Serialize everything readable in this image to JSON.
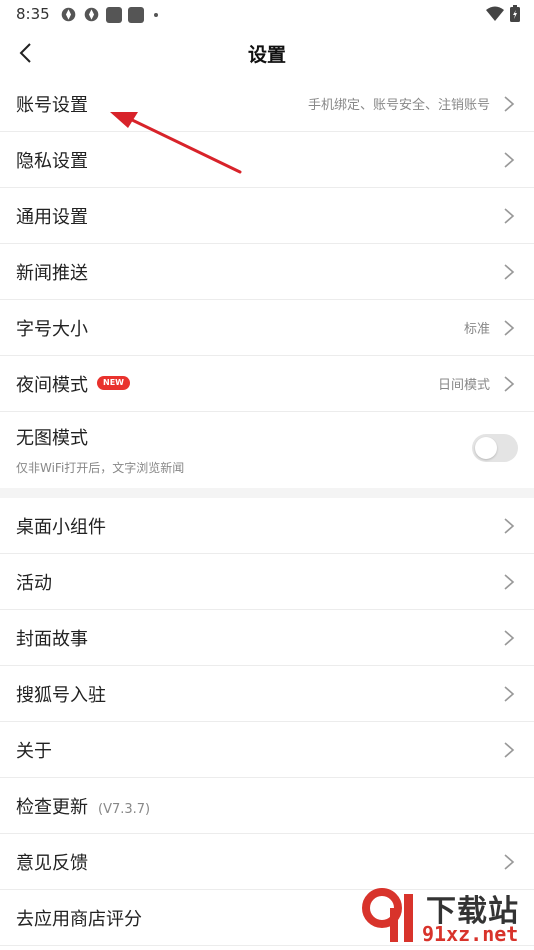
{
  "status": {
    "time": "8:35"
  },
  "header": {
    "title": "设置"
  },
  "rows": {
    "account": {
      "label": "账号设置",
      "value": "手机绑定、账号安全、注销账号"
    },
    "privacy": {
      "label": "隐私设置"
    },
    "general": {
      "label": "通用设置"
    },
    "news_push": {
      "label": "新闻推送"
    },
    "font_size": {
      "label": "字号大小",
      "value": "标准"
    },
    "night_mode": {
      "label": "夜间模式",
      "badge": "NEW",
      "value": "日间模式"
    },
    "no_image": {
      "label": "无图模式",
      "sub": "仅非WiFi打开后，文字浏览新闻",
      "enabled": false
    },
    "widget": {
      "label": "桌面小组件"
    },
    "activity": {
      "label": "活动"
    },
    "cover_story": {
      "label": "封面故事"
    },
    "sohu_account": {
      "label": "搜狐号入驻"
    },
    "about": {
      "label": "关于"
    },
    "check_update": {
      "label": "检查更新",
      "version": "(V7.3.7)"
    },
    "feedback": {
      "label": "意见反馈"
    },
    "rate": {
      "label": "去应用商店评分"
    }
  },
  "watermark": {
    "line1": "下载站",
    "line2": "91xz.net"
  },
  "colors": {
    "accent_red": "#e9322d",
    "annotation_arrow": "#d8232a"
  }
}
